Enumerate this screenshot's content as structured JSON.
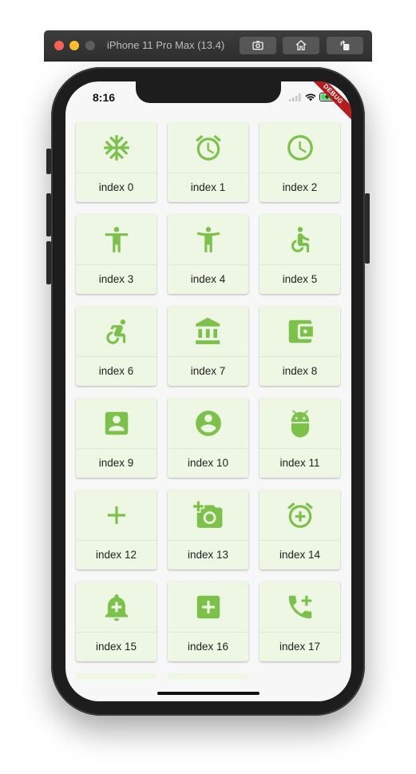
{
  "simulator": {
    "title": "iPhone 11 Pro Max (13.4)",
    "buttons": [
      "screenshot-icon",
      "home-icon",
      "rotate-icon"
    ]
  },
  "status_bar": {
    "time": "8:16",
    "debug_label": "DEBUG"
  },
  "colors": {
    "accent": "#7cc14a",
    "card_bg": "#eef6e4",
    "screen_bg": "#f7f7f7"
  },
  "grid": {
    "items": [
      {
        "label": "index 0",
        "icon": "ac-unit-icon"
      },
      {
        "label": "index 1",
        "icon": "access-alarm-icon"
      },
      {
        "label": "index 2",
        "icon": "access-time-icon"
      },
      {
        "label": "index 3",
        "icon": "accessibility-icon"
      },
      {
        "label": "index 4",
        "icon": "accessibility-new-icon"
      },
      {
        "label": "index 5",
        "icon": "accessible-icon"
      },
      {
        "label": "index 6",
        "icon": "accessible-forward-icon"
      },
      {
        "label": "index 7",
        "icon": "account-balance-icon"
      },
      {
        "label": "index 8",
        "icon": "account-balance-wallet-icon"
      },
      {
        "label": "index 9",
        "icon": "account-box-icon"
      },
      {
        "label": "index 10",
        "icon": "account-circle-icon"
      },
      {
        "label": "index 11",
        "icon": "adb-icon"
      },
      {
        "label": "index 12",
        "icon": "add-icon"
      },
      {
        "label": "index 13",
        "icon": "add-a-photo-icon"
      },
      {
        "label": "index 14",
        "icon": "add-alarm-icon"
      },
      {
        "label": "index 15",
        "icon": "add-alert-icon"
      },
      {
        "label": "index 16",
        "icon": "add-box-icon"
      },
      {
        "label": "index 17",
        "icon": "add-call-icon"
      }
    ]
  }
}
